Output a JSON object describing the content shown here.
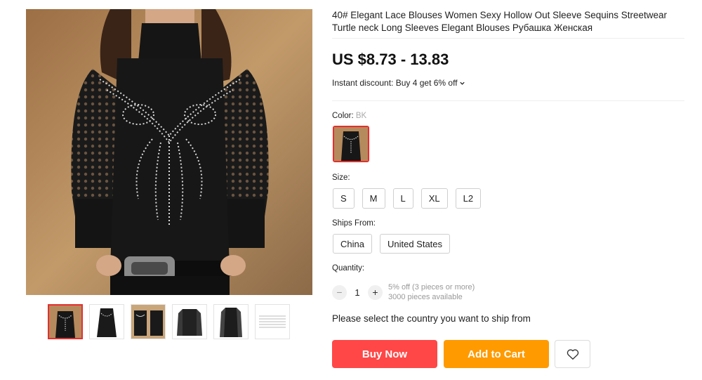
{
  "product": {
    "title": "40# Elegant Lace Blouses Women Sexy Hollow Out Sleeve Sequins Streetwear Turtle neck Long Sleeves Elegant Blouses Рубашка Женская",
    "price": "US $8.73 - 13.83",
    "discount_label": "Instant discount: Buy 4 get 6% off",
    "discount_icon": "chevron-down-icon"
  },
  "color": {
    "label": "Color:",
    "selected": "BK"
  },
  "size": {
    "label": "Size:",
    "options": [
      "S",
      "M",
      "L",
      "XL",
      "L2"
    ]
  },
  "ships_from": {
    "label": "Ships From:",
    "options": [
      "China",
      "United States"
    ]
  },
  "quantity": {
    "label": "Quantity:",
    "minus": "−",
    "plus": "+",
    "value": "1",
    "offer": "5% off (3 pieces or more)",
    "available": "3000 pieces available"
  },
  "ship_note": "Please select the country you want to ship from",
  "actions": {
    "buy_now": "Buy Now",
    "add_to_cart": "Add to Cart",
    "wishlist_icon": "heart-icon"
  },
  "gallery": {
    "thumbnail_count": 6,
    "active_index": 0
  },
  "colors": {
    "accent_red": "#ff4747",
    "accent_orange": "#ff9a00",
    "selected_border": "#e62e2e"
  }
}
